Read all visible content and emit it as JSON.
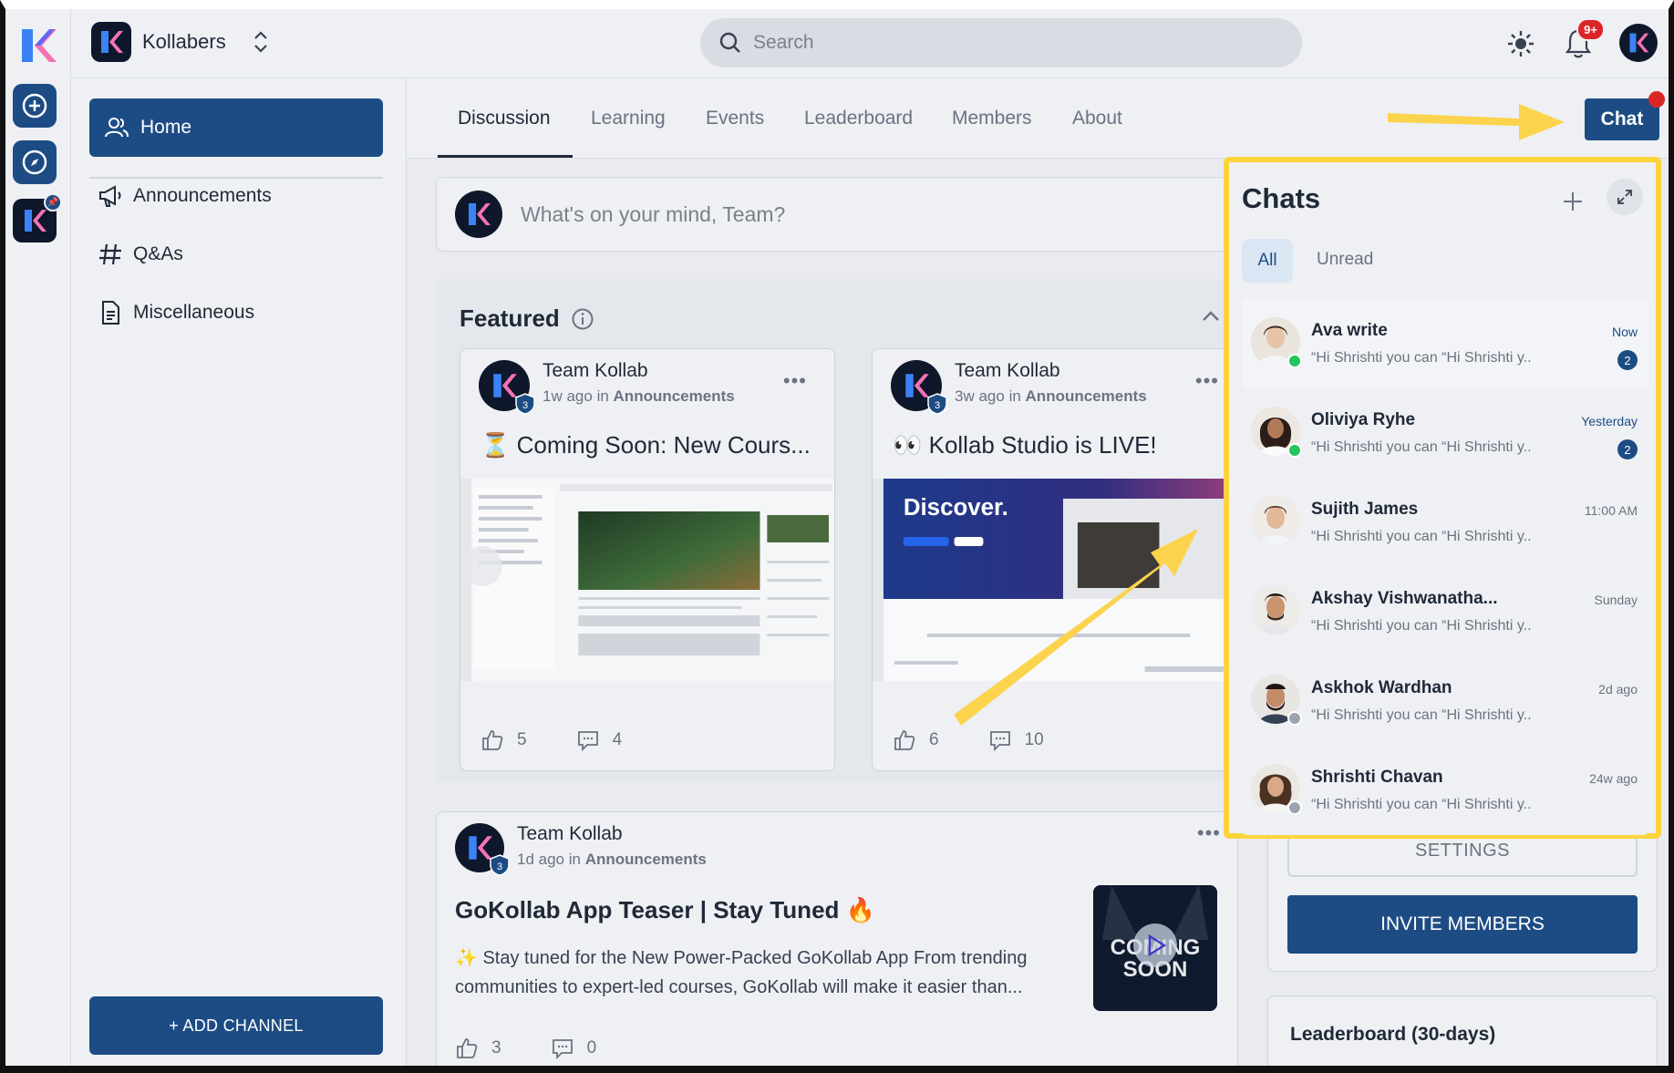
{
  "community": {
    "name": "Kollabers"
  },
  "search": {
    "placeholder": "Search"
  },
  "notifications": {
    "count": "9+"
  },
  "nav": {
    "home": "Home",
    "items": [
      "Announcements",
      "Q&As",
      "Miscellaneous"
    ],
    "add_channel": "+ ADD CHANNEL"
  },
  "tabs": [
    "Discussion",
    "Learning",
    "Events",
    "Leaderboard",
    "Members",
    "About"
  ],
  "composer": {
    "placeholder": "What's on your mind, Team?"
  },
  "featured": {
    "title": "Featured",
    "cards": [
      {
        "author": "Team Kollab",
        "time": "1w ago",
        "in": "in",
        "channel": "Announcements",
        "title": "⏳ Coming Soon: New Cours...",
        "likes": "5",
        "comments": "4"
      },
      {
        "author": "Team Kollab",
        "time": "3w ago",
        "in": "in",
        "channel": "Announcements",
        "title": "👀 Kollab Studio is LIVE!",
        "likes": "6",
        "comments": "10"
      }
    ]
  },
  "post": {
    "author": "Team Kollab",
    "time": "1d ago",
    "in": "in",
    "channel": "Announcements",
    "title": "GoKollab App Teaser | Stay Tuned 🔥",
    "body": "✨ Stay tuned for the New Power-Packed GoKollab App From trending communities to expert-led courses, GoKollab will make it easier than...",
    "thumb_text_1": "COMING",
    "thumb_text_2": "SOON",
    "likes": "3",
    "comments": "0"
  },
  "right": {
    "settings": "SETTINGS",
    "invite": "INVITE MEMBERS",
    "leaderboard_title": "Leaderboard (30-days)"
  },
  "chat_button": "Chat",
  "chats": {
    "title": "Chats",
    "filters": [
      "All",
      "Unread"
    ],
    "items": [
      {
        "name": "Ava write",
        "preview": "“Hi Shrishti you can “Hi Shrishti y..",
        "time": "Now",
        "unread": "2",
        "online": true
      },
      {
        "name": "Oliviya Ryhe",
        "preview": "“Hi Shrishti you can “Hi Shrishti y..",
        "time": "Yesterday",
        "unread": "2",
        "online": true
      },
      {
        "name": "Sujith James",
        "preview": "“Hi Shrishti you can “Hi Shrishti y..",
        "time": "11:00 AM",
        "unread": "",
        "online": null
      },
      {
        "name": "Akshay Vishwanatha...",
        "preview": "“Hi Shrishti you can “Hi Shrishti y..",
        "time": "Sunday",
        "unread": "",
        "online": null
      },
      {
        "name": "Askhok Wardhan",
        "preview": "“Hi Shrishti you can “Hi Shrishti y..",
        "time": "2d ago",
        "unread": "",
        "online": false
      },
      {
        "name": "Shrishti Chavan",
        "preview": "“Hi Shrishti you can “Hi Shrishti y..",
        "time": "24w ago",
        "unread": "",
        "online": false
      }
    ]
  },
  "colors": {
    "brand": "#1d4c84",
    "highlight": "#fbd43c",
    "alert": "#dc2626",
    "online": "#22c55e",
    "offline": "#9ca3af"
  }
}
